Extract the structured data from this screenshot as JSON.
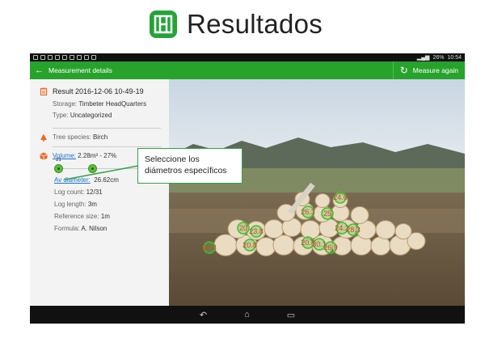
{
  "slide": {
    "title": "Resultados"
  },
  "status_bar": {
    "battery": "26%",
    "time": "10:54"
  },
  "app_bar": {
    "back_label": "Measurement details",
    "action_label": "Measure again"
  },
  "details": {
    "result": "Result 2016-12-06 10-49-19",
    "storage_label": "Storage:",
    "storage_value": "Timbeter HeadQuarters",
    "type_label": "Type:",
    "type_value": "Uncategorized",
    "species_label": "Tree species:",
    "species_value": "Birch",
    "volume_label": "Volume:",
    "volume_value": "2.28m³ - 27%",
    "slider_min": "21",
    "av_diameter_label": "Av diameter:",
    "av_diameter_value": "26.62cm",
    "log_count_label": "Log count:",
    "log_count_value": "12/31",
    "log_length_label": "Log length:",
    "log_length_value": "3m",
    "ref_size_label": "Reference size:",
    "ref_size_value": "1m",
    "formula_label": "Formula:",
    "formula_value": "A. Nilson"
  },
  "log_markers": [
    "24.6",
    "26.3",
    "25",
    "20",
    "23.8",
    "24.2",
    "28.3",
    "20.8",
    "20.4",
    "30.1",
    "26.3",
    "26.9"
  ],
  "callout": {
    "line1": "Seleccione los",
    "line2": "diámetros específicos"
  },
  "colors": {
    "brand_green": "#27a32b",
    "accent_orange": "#f26522",
    "marker_red": "#e53935"
  }
}
